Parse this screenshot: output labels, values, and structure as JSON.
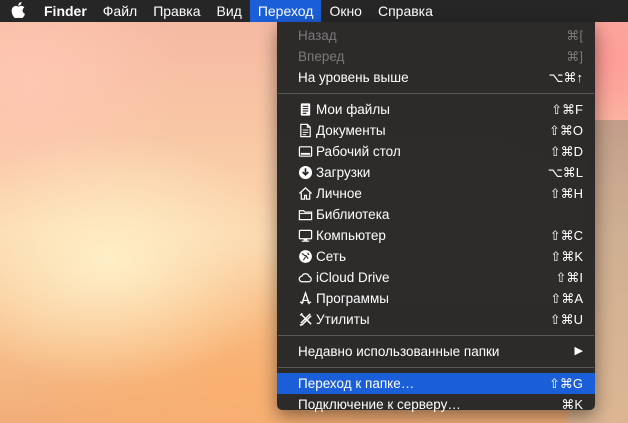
{
  "menubar": {
    "app_name": "Finder",
    "items": [
      "Файл",
      "Правка",
      "Вид",
      "Переход",
      "Окно",
      "Справка"
    ]
  },
  "dropdown": {
    "nav": [
      {
        "label": "Назад",
        "shortcut": "⌘[",
        "enabled": false
      },
      {
        "label": "Вперед",
        "shortcut": "⌘]",
        "enabled": false
      },
      {
        "label": "На уровень выше",
        "shortcut": "⌥⌘↑",
        "enabled": true
      }
    ],
    "places": [
      {
        "icon": "my-files-icon",
        "label": "Мои файлы",
        "shortcut": "⇧⌘F"
      },
      {
        "icon": "documents-icon",
        "label": "Документы",
        "shortcut": "⇧⌘O"
      },
      {
        "icon": "desktop-icon",
        "label": "Рабочий стол",
        "shortcut": "⇧⌘D"
      },
      {
        "icon": "downloads-icon",
        "label": "Загрузки",
        "shortcut": "⌥⌘L"
      },
      {
        "icon": "home-icon",
        "label": "Личное",
        "shortcut": "⇧⌘H"
      },
      {
        "icon": "folder-icon",
        "label": "Библиотека",
        "shortcut": ""
      },
      {
        "icon": "computer-icon",
        "label": "Компьютер",
        "shortcut": "⇧⌘C"
      },
      {
        "icon": "network-icon",
        "label": "Сеть",
        "shortcut": "⇧⌘K"
      },
      {
        "icon": "cloud-icon",
        "label": "iCloud Drive",
        "shortcut": "⇧⌘I"
      },
      {
        "icon": "applications-icon",
        "label": "Программы",
        "shortcut": "⇧⌘A"
      },
      {
        "icon": "utilities-icon",
        "label": "Утилиты",
        "shortcut": "⇧⌘U"
      }
    ],
    "recent_folders": {
      "label": "Недавно использованные папки",
      "arrow": "▶"
    },
    "goto_folder": {
      "label": "Переход к папке…",
      "shortcut": "⇧⌘G"
    },
    "connect_server": {
      "label": "Подключение к серверу…",
      "shortcut": "⌘K"
    }
  },
  "colors": {
    "menubar_bg": "#262626",
    "highlight": "#1a5fd8",
    "disabled_text": "#7a7a7a"
  }
}
